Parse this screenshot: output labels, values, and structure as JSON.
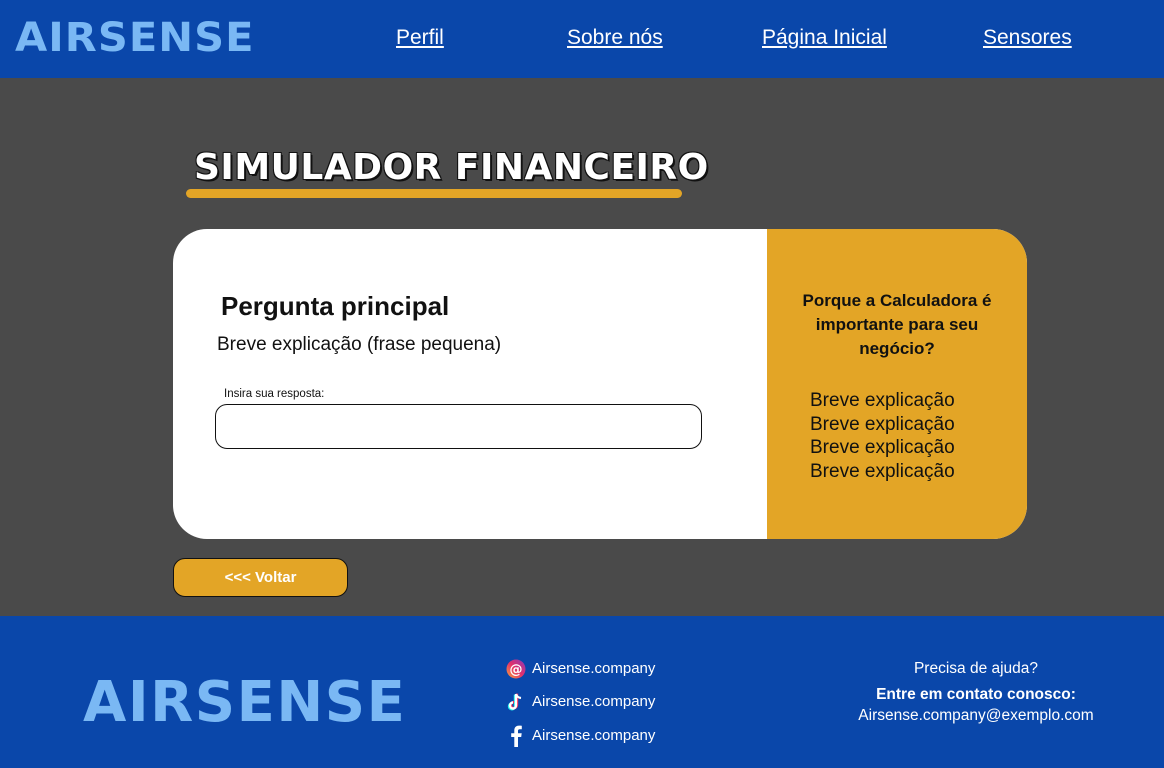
{
  "header": {
    "logo": "AIRSENSE",
    "nav": [
      "Perfil",
      "Sobre nós",
      "Página Inicial",
      "Sensores"
    ]
  },
  "page": {
    "title": "SIMULADOR FINANCEIRO"
  },
  "card": {
    "question": "Pergunta principal",
    "question_sub": "Breve explicação (frase pequena)",
    "answer_label": "Insira sua resposta:",
    "answer_value": "",
    "side_heading": "Porque a Calculadora é importante para seu negócio?",
    "side_items": [
      "Breve explicação",
      "Breve explicação",
      "Breve explicação",
      "Breve explicação"
    ]
  },
  "back_button": "<<< Voltar",
  "footer": {
    "logo": "AIRSENSE",
    "socials": [
      {
        "icon": "threads-icon",
        "label": "Airsense.company"
      },
      {
        "icon": "tiktok-icon",
        "label": "Airsense.company"
      },
      {
        "icon": "facebook-icon",
        "label": "Airsense.company"
      }
    ],
    "help_question": "Precisa de ajuda?",
    "help_contact": "Entre em contato conosco:",
    "help_email": "Airsense.company@exemplo.com"
  },
  "colors": {
    "primary_blue": "#0a47aa",
    "logo_blue": "#7ab8f4",
    "accent": "#e3a526",
    "background": "#4a4a4a"
  }
}
